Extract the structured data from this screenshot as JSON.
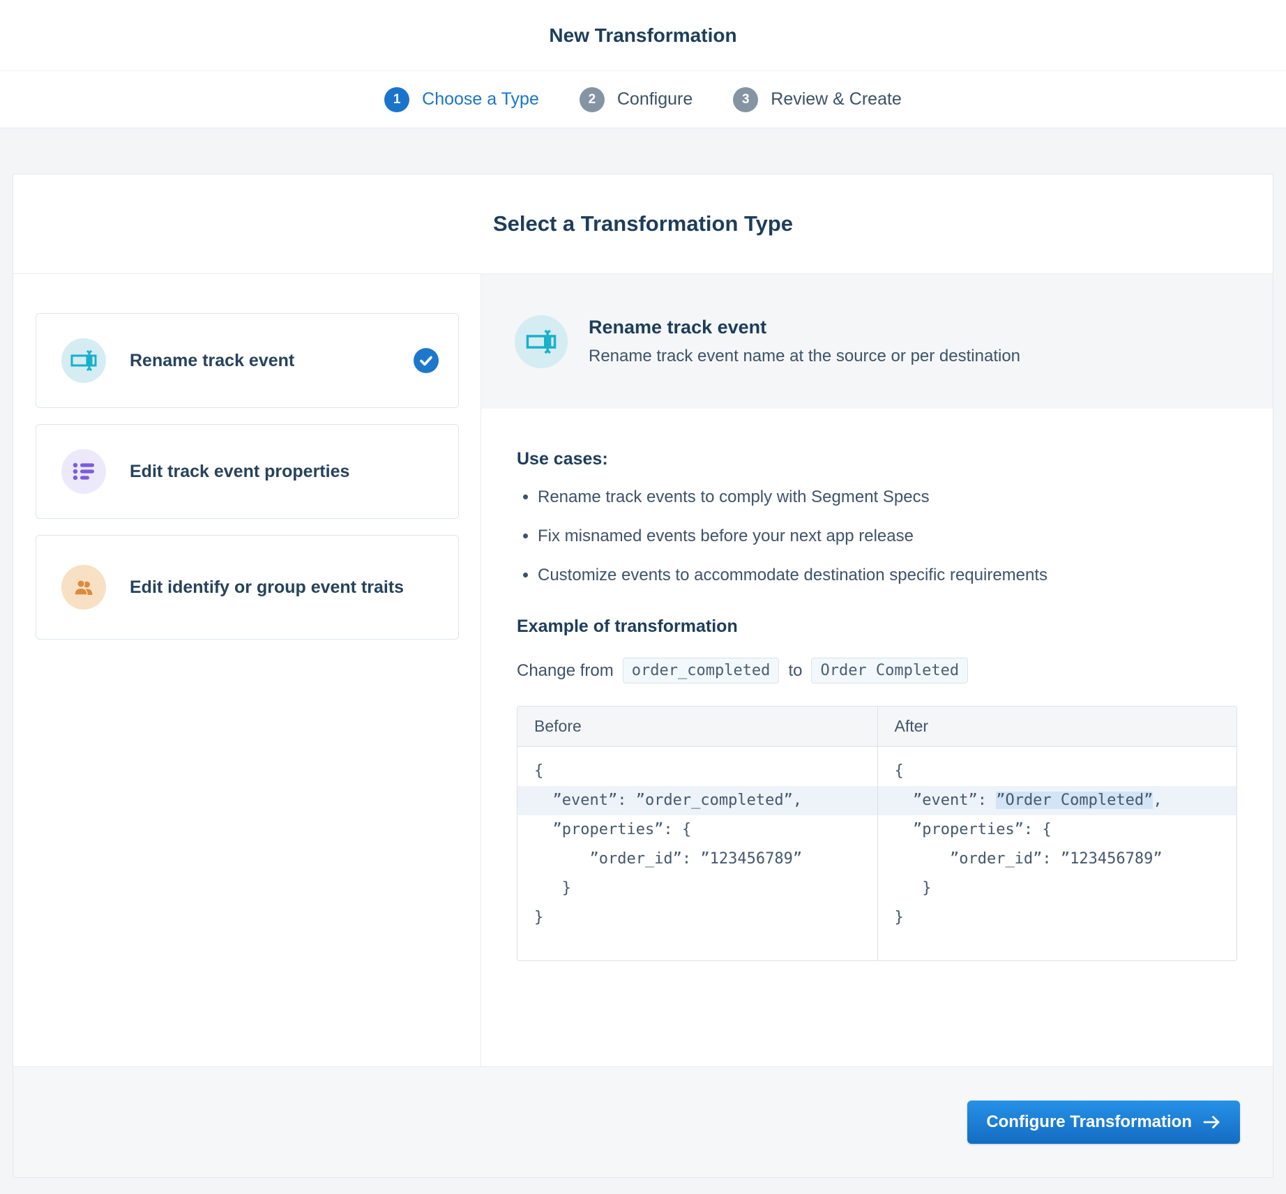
{
  "header": {
    "title": "New Transformation"
  },
  "steps": [
    {
      "number": "1",
      "label": "Choose a Type",
      "state": "active"
    },
    {
      "number": "2",
      "label": "Configure",
      "state": "upcoming"
    },
    {
      "number": "3",
      "label": "Review & Create",
      "state": "upcoming"
    }
  ],
  "card": {
    "title": "Select a Transformation Type"
  },
  "options": [
    {
      "label": "Rename track event",
      "selected": true
    },
    {
      "label": "Edit track event properties",
      "selected": false
    },
    {
      "label": "Edit identify or group event traits",
      "selected": false
    }
  ],
  "detail": {
    "title": "Rename track event",
    "description": "Rename track event name at the source or per destination",
    "use_cases_heading": "Use cases:",
    "use_cases": [
      "Rename track events to comply with Segment Specs",
      "Fix misnamed events before your next app release",
      "Customize events to accommodate destination specific requirements"
    ],
    "example_heading": "Example of transformation",
    "change": {
      "prefix": "Change from",
      "from": "order_completed",
      "connector": "to",
      "to": "Order Completed"
    },
    "table": {
      "columns": [
        "Before",
        "After"
      ],
      "before": {
        "line_open": "{",
        "line_event": "  ”event”: ”order_completed”,",
        "line_properties": "  ”properties”: {",
        "line_order_id": "      ”order_id”: ”123456789”",
        "line_close_inner": "   }",
        "line_close": "}"
      },
      "after": {
        "line_open": "{",
        "event_prefix": "  ”event”: ",
        "event_highlight": "”Order Completed”",
        "event_suffix": ",",
        "line_properties": "  ”properties”: {",
        "line_order_id": "      ”order_id”: ”123456789”",
        "line_close_inner": "   }",
        "line_close": "}"
      }
    }
  },
  "footer": {
    "button_label": "Configure Transformation"
  },
  "icons": {
    "option_rename": "rename-cursor-icon",
    "option_properties": "bullet-list-icon",
    "option_traits": "people-icon",
    "selected": "check-circle-icon",
    "button_arrow": "arrow-right-icon"
  },
  "colors": {
    "primary_blue": "#1b74cc",
    "button_gradient_top": "#2691e8",
    "button_gradient_bottom": "#146cc2",
    "step_inactive_gray": "#8494a3",
    "teal_icon": "#17b0cb",
    "teal_icon_bg": "#d4ecf2",
    "purple_icon": "#7c5cdc",
    "purple_icon_bg": "#ece9fb",
    "orange_icon": "#dd8a3d",
    "orange_icon_bg": "#f8e0c4",
    "event_row_highlight": "#eef3f9",
    "renamed_value_highlight": "#d2e4f6",
    "heading_navy": "#1d3d5a"
  }
}
